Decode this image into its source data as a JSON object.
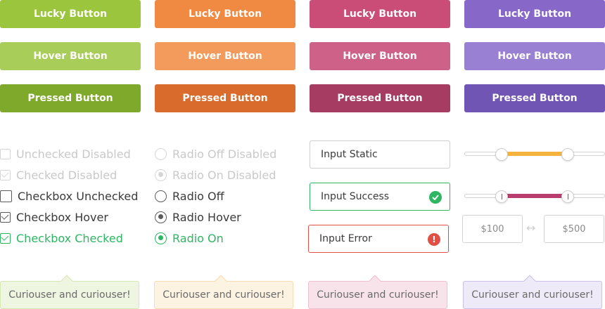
{
  "colors": {
    "green": [
      "#9bc53d",
      "#a8cd58",
      "#7ea92a"
    ],
    "orange": [
      "#f08a43",
      "#f29b5c",
      "#d96c2c"
    ],
    "pink": [
      "#c94d77",
      "#cd6188",
      "#a63c61"
    ],
    "purple": [
      "#8767c7",
      "#9a80d2",
      "#7155b5"
    ],
    "success": "#2eb662",
    "error": "#e05045",
    "slider_orange": "#f5b43d",
    "slider_pink": "#b83c6d"
  },
  "buttons": {
    "static_label": "Lucky Button",
    "hover_label": "Hover Button",
    "pressed_label": "Pressed Button"
  },
  "checkboxes": {
    "unchecked_disabled": "Unchecked Disabled",
    "checked_disabled": "Checked Disabled",
    "unchecked": "Checkbox Unchecked",
    "hover": "Checkbox Hover",
    "checked": "Checkbox Checked"
  },
  "radios": {
    "off_disabled": "Radio Off Disabled",
    "on_disabled": "Radio On Disabled",
    "off": "Radio Off",
    "hover": "Radio Hover",
    "on": "Radio On"
  },
  "inputs": {
    "static_value": "Input Static",
    "success_value": "Input Success",
    "error_value": "Input Error",
    "success_icon": "check-circle-icon",
    "error_icon": "exclamation-circle-icon",
    "error_symbol": "!"
  },
  "sliders": {
    "single_range": [
      0.26,
      0.74
    ],
    "dual_range": [
      0.26,
      0.74
    ]
  },
  "price_range": {
    "min": "$100",
    "max": "$500",
    "separator_icon": "double-arrow-icon"
  },
  "tooltips": {
    "text": "Curiouser and curiouser!"
  }
}
